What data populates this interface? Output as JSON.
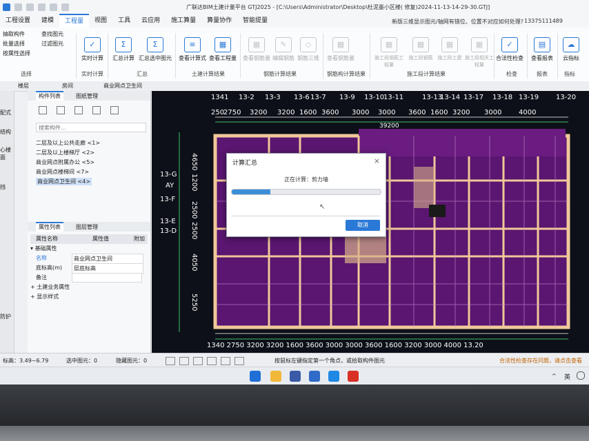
{
  "window": {
    "title": "广联达BIM土建计量平台 GTJ2025 - [C:\\Users\\Administrator\\Desktop\\杜泥墨小区楼( 修复)2024-11-13-14-29-30.GTJ]"
  },
  "menu": {
    "items": [
      "工程设置",
      "建模",
      "工程量",
      "视图",
      "工具",
      "云应用",
      "施工算量",
      "算量协作",
      "智能提量"
    ]
  },
  "help_text": "新版三维显示图元/轴网有错位、位置不对应如何处理?",
  "user_phone": "13375111489",
  "ribbon": {
    "left_cmds": [
      "抽取构件",
      "批量选择",
      "按属性选择"
    ],
    "left_group": "选择",
    "buttons": [
      {
        "label": "实时计算",
        "icon": "✓"
      },
      {
        "label": "汇总计算",
        "icon": "Σ"
      },
      {
        "label": "汇总选中图元",
        "icon": "Σ"
      },
      {
        "label": "查看计算式",
        "icon": "≡"
      },
      {
        "label": "查看工程量",
        "icon": "▦"
      },
      {
        "label": "查看钢筋量",
        "icon": "▦"
      },
      {
        "label": "编辑钢筋",
        "icon": "✎"
      },
      {
        "label": "钢筋三维",
        "icon": "◇"
      },
      {
        "label": "查看钢筋量",
        "icon": "▦"
      },
      {
        "label": "施工段钢筋工程量",
        "icon": "▦"
      },
      {
        "label": "施工段钢筋",
        "icon": "▦"
      },
      {
        "label": "施工段土建",
        "icon": "▦"
      },
      {
        "label": "施工段相关工程量",
        "icon": "▦"
      },
      {
        "label": "合法性检查",
        "icon": "✓"
      },
      {
        "label": "查看报表",
        "icon": "▤"
      },
      {
        "label": "云指标",
        "icon": "☁"
      }
    ],
    "extra": "查找图元",
    "extra2": "过滤图元",
    "groups": [
      "实时计算",
      "汇总",
      "土建计算结果",
      "钢筋计算结果",
      "钢筋构计算结果",
      "施工段计算结果",
      "检查",
      "报表",
      "指标"
    ]
  },
  "toolbar2": {
    "layer": "楼层",
    "item": "房间",
    "component": "商业网点卫生间"
  },
  "left_strip": [
    "配式",
    "结构",
    "心楼面",
    "挡",
    "防护"
  ],
  "component_panel": {
    "tabs": [
      "构件列表",
      "图纸管理"
    ],
    "search_placeholder": "搜索构件...",
    "items": [
      "二层及以上公共走廊 <1>",
      "二层及以上楼梯厅 <2>",
      "商业网点附属办公 <5>",
      "商业网点楼梯间 <7>",
      "商业网点卫生间 <4>"
    ]
  },
  "property_panel": {
    "tabs": [
      "属性列表",
      "图层管理"
    ],
    "headers": [
      "属性名称",
      "属性值",
      "附加"
    ],
    "sections": [
      "基础属性",
      "土建业务属性",
      "显示样式"
    ],
    "rows": [
      {
        "name": "名称",
        "value": "商业网点卫生间"
      },
      {
        "name": "底标高(m)",
        "value": "层底标高"
      },
      {
        "name": "备注",
        "value": ""
      }
    ]
  },
  "canvas": {
    "top_axes": [
      "1341",
      "13-2",
      "13-3",
      "13-6",
      "13-7",
      "13-9",
      "13-10",
      "13-11",
      "13-13",
      "13-14",
      "13-17",
      "13-18",
      "13-19",
      "13-20"
    ],
    "top_dims": [
      "250",
      "2750",
      "3200",
      "3200",
      "1600",
      "3600",
      "3000",
      "3000",
      "3600",
      "1600",
      "3200",
      "3000",
      "4000"
    ],
    "overall_dim": "39200",
    "left_axes": [
      "13-G",
      "AY",
      "13-F",
      "13-E",
      "13-D"
    ],
    "left_dims": [
      "4650",
      "1200",
      "2500",
      "2500",
      "4050",
      "5250"
    ],
    "bottom_axes": "1340 2750 3200 3200 1600 3600 3000 3000 3600 1600 3200 3000 4000 13.20"
  },
  "dialog": {
    "title": "计算汇总",
    "status": "正在计算：剪力墙",
    "progress": 0.26,
    "cancel": "取消"
  },
  "statusbar": {
    "elevation": "标高：3.49~6.79",
    "selected": "选中图元：0",
    "hidden": "隐藏图元：0",
    "hint": "按鼠标左键指定第一个角点，或拾取构件图元",
    "warning": "合法性检查存在问题，请点击查看"
  },
  "taskbar": {
    "lang": "英"
  }
}
